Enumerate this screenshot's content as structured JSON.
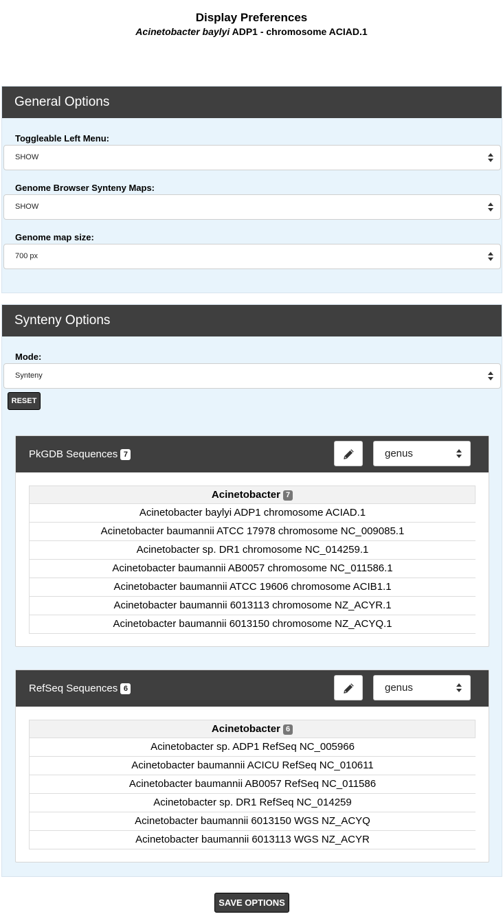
{
  "header": {
    "title": "Display Preferences",
    "subtitle_italic": "Acinetobacter baylyi",
    "subtitle_rest": " ADP1 - chromosome ACIAD.1"
  },
  "general": {
    "title": "General Options",
    "fields": [
      {
        "label": "Toggleable Left Menu:",
        "value": "SHOW"
      },
      {
        "label": "Genome Browser Synteny Maps:",
        "value": "SHOW"
      },
      {
        "label": "Genome map size:",
        "value": "700 px"
      }
    ]
  },
  "synteny": {
    "title": "Synteny Options",
    "mode_label": "Mode:",
    "mode_value": "Synteny",
    "reset_label": "RESET"
  },
  "pkgdb": {
    "title": "PkGDB Sequences",
    "count": "7",
    "group_select": "genus",
    "group_name": "Acinetobacter",
    "group_count": "7",
    "rows": [
      "Acinetobacter baylyi ADP1 chromosome ACIAD.1",
      "Acinetobacter baumannii ATCC 17978 chromosome NC_009085.1",
      "Acinetobacter sp. DR1 chromosome NC_014259.1",
      "Acinetobacter baumannii AB0057 chromosome NC_011586.1",
      "Acinetobacter baumannii ATCC 19606 chromosome ACIB1.1",
      "Acinetobacter baumannii 6013113 chromosome NZ_ACYR.1",
      "Acinetobacter baumannii 6013150 chromosome NZ_ACYQ.1"
    ]
  },
  "refseq": {
    "title": "RefSeq Sequences",
    "count": "6",
    "group_select": "genus",
    "group_name": "Acinetobacter",
    "group_count": "6",
    "rows": [
      "Acinetobacter sp. ADP1 RefSeq NC_005966",
      "Acinetobacter baumannii ACICU RefSeq NC_010611",
      "Acinetobacter baumannii AB0057 RefSeq NC_011586",
      "Acinetobacter sp. DR1 RefSeq NC_014259",
      "Acinetobacter baumannii 6013150 WGS NZ_ACYQ",
      "Acinetobacter baumannii 6013113 WGS NZ_ACYR"
    ]
  },
  "footer": {
    "save_label": "SAVE OPTIONS"
  },
  "icons": {
    "edit": "pencil-icon",
    "select": "select-arrows-icon"
  },
  "colors": {
    "panel_header": "#3f3f3f",
    "panel_background": "#e8f4fc"
  }
}
